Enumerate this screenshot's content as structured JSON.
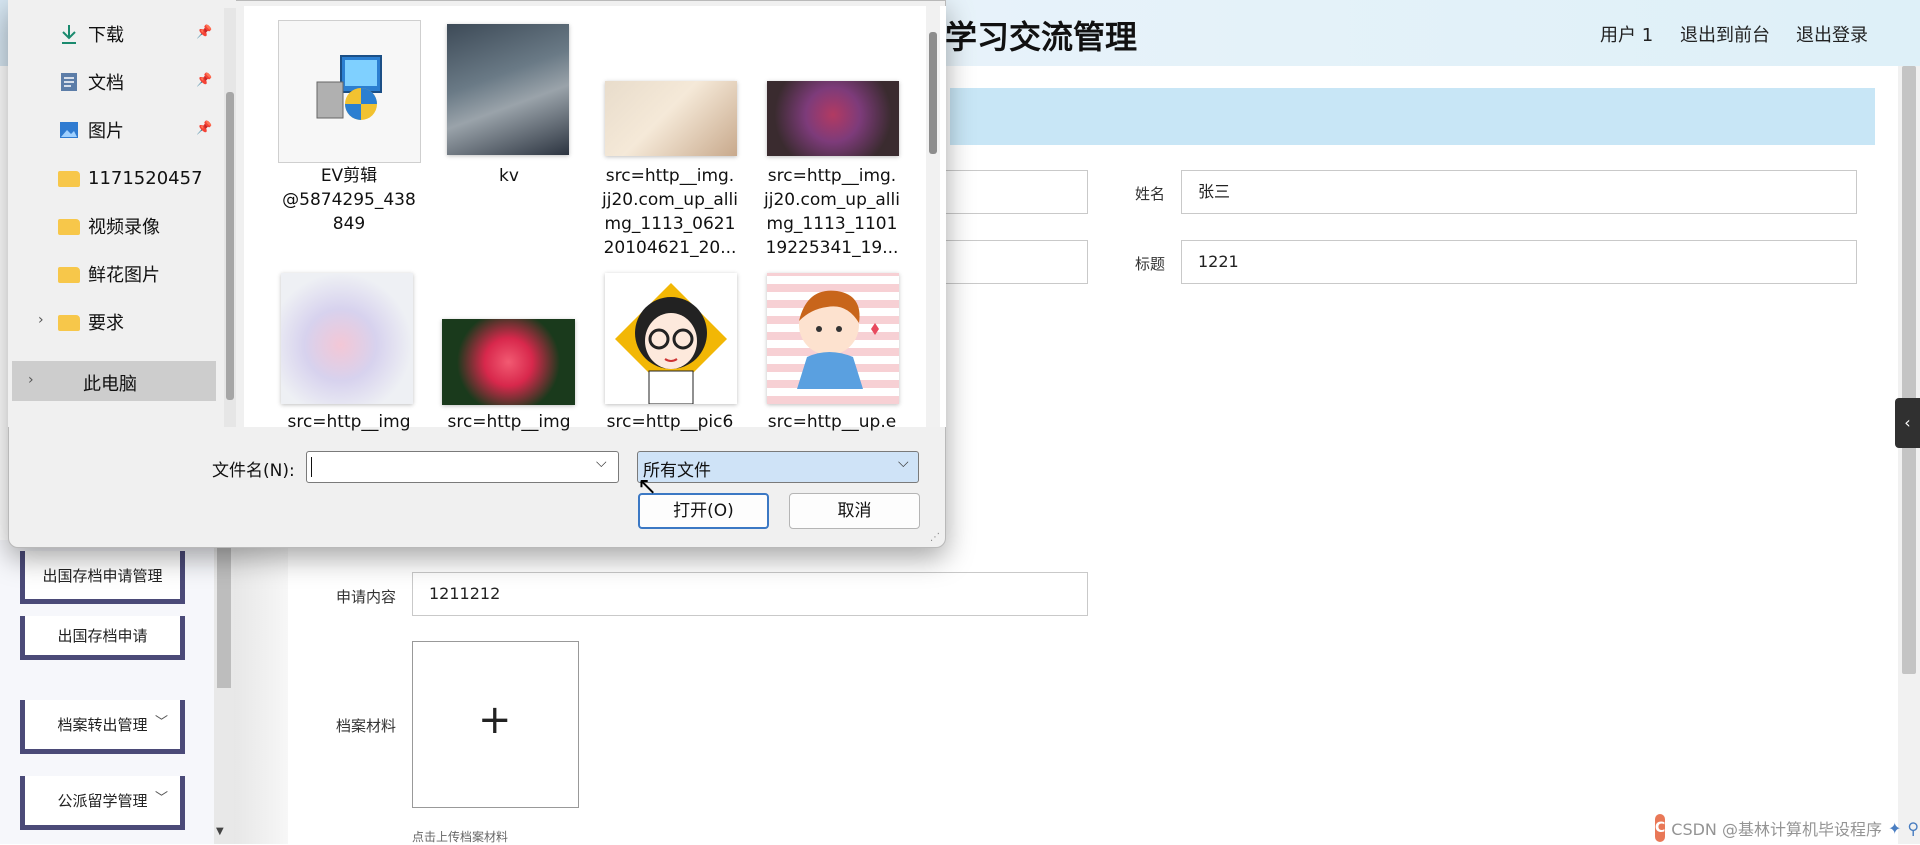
{
  "header": {
    "title": "学习交流管理",
    "user": "用户 1",
    "to_front": "退出到前台",
    "logout": "退出登录"
  },
  "sidebar": {
    "items": [
      {
        "label": "出国存档申请管理"
      },
      {
        "label": "出国存档申请"
      },
      {
        "label": "档案转出管理"
      },
      {
        "label": "公派留学管理"
      }
    ]
  },
  "form": {
    "name_label": "姓名",
    "name_value": "张三",
    "title_label": "标题",
    "title_value": "1221",
    "content_label": "申请内容",
    "content_value": "1211212",
    "material_label": "档案材料",
    "upload_hint": "点击上传档案材料"
  },
  "dialog": {
    "nav": {
      "items": [
        {
          "label": "下载",
          "icon": "download-icon",
          "pinned": true
        },
        {
          "label": "文档",
          "icon": "document-icon",
          "pinned": true
        },
        {
          "label": "图片",
          "icon": "pictures-icon",
          "pinned": true
        },
        {
          "label": "1171520457",
          "icon": "folder-icon"
        },
        {
          "label": "视频录像",
          "icon": "folder-icon"
        },
        {
          "label": "鲜花图片",
          "icon": "folder-icon"
        },
        {
          "label": "要求",
          "icon": "folder-icon"
        }
      ],
      "this_pc": "此电脑"
    },
    "files": [
      {
        "name": "EV剪辑@5874295_438849",
        "line1": "EV剪辑",
        "line2": "@5874295_438",
        "line3": "849"
      },
      {
        "name": "kv",
        "line1": "kv"
      },
      {
        "name": "src=http__img.jj20.com_up_allimg_1113_062120104621_20...",
        "line1": "src=http__img.",
        "line2": "jj20.com_up_alli",
        "line3": "mg_1113_0621",
        "line4": "20104621_20..."
      },
      {
        "name": "src=http__img.jj20.com_up_allimg_1113_110119225341_19...",
        "line1": "src=http__img.",
        "line2": "jj20.com_up_alli",
        "line3": "mg_1113_1101",
        "line4": "19225341_19..."
      },
      {
        "name": "src=http__img",
        "line1": "src=http__img"
      },
      {
        "name": "src=http__img",
        "line1": "src=http__img"
      },
      {
        "name": "src=http__pic6",
        "line1": "src=http__pic6"
      },
      {
        "name": "src=http__up.e",
        "line1": "src=http__up.e"
      }
    ],
    "filename_label": "文件名(N):",
    "filename_value": "",
    "filetype_value": "所有文件",
    "open_button": "打开(O)",
    "cancel_button": "取消"
  },
  "watermark": {
    "text": "CSDN @基林计算机毕设程序"
  },
  "colors": {
    "accent_border": "#4b4a78",
    "header_band": "#c8e6f6",
    "select_bg": "#cfe3f7",
    "open_border": "#3b78c4"
  }
}
